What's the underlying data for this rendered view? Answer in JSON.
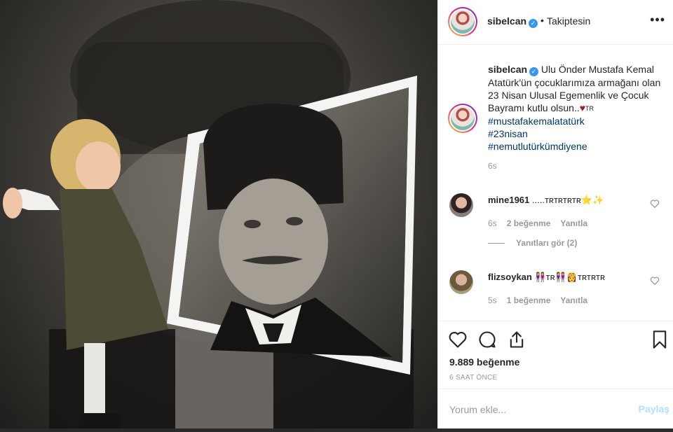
{
  "post": {
    "username": "sibelcan",
    "dot": "•",
    "follow_status": "Takiptesin",
    "more_icon": "more-horizontal-icon"
  },
  "caption": {
    "username": "sibelcan",
    "body": "Ulu Önder Mustafa Kemal Atatürk'ün çocuklarımıza armağanı olan 23 Nisan Ulusal Egemenlik ve Çocuk Bayramı kutlu olsun..",
    "suffix": "TR",
    "hashtags": [
      "#mustafakemalatatürk",
      "#23nisan",
      "#nemutlutürkümdiyene"
    ],
    "time": "6s"
  },
  "comments": [
    {
      "username": "mine1961",
      "text": ".....ᴛʀᴛʀᴛʀᴛʀ⭐✨",
      "time": "6s",
      "likes": "2 beğenme",
      "reply": "Yanıtla"
    },
    {
      "username": "flizsoykan",
      "text": "👭ᴛʀ👭👸ᴛʀᴛʀᴛʀ",
      "time": "5s",
      "likes": "1 beğenme",
      "reply": "Yanıtla"
    }
  ],
  "view_replies": "Yanıtları gör (2)",
  "actions": {
    "likes": "9.889 beğenme",
    "age": "6 SAAT ÖNCE"
  },
  "composer": {
    "placeholder": "Yorum ekle...",
    "post_label": "Paylaş"
  },
  "colors": {
    "link": "#003569",
    "verified": "#3897f0",
    "post_disabled": "#b2dffc",
    "heart": "#a51d2d"
  }
}
